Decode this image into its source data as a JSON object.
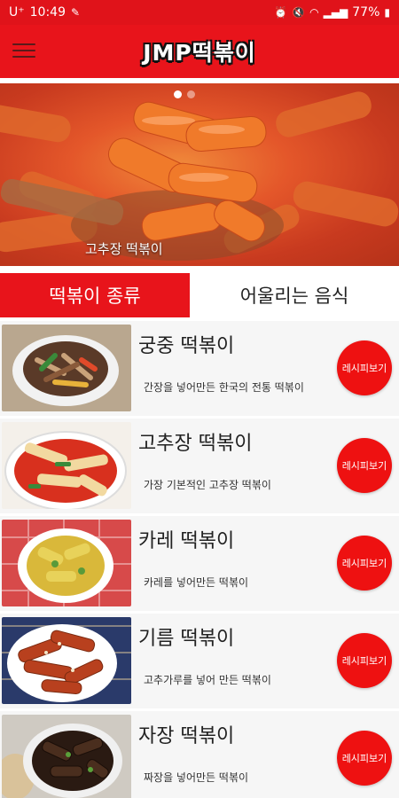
{
  "status_bar": {
    "carrier": "U⁺",
    "time": "10:49",
    "battery": "77%"
  },
  "app_bar": {
    "title": "JMP떡볶이",
    "menu_icon": "hamburger-menu-icon"
  },
  "hero": {
    "caption": "고추장 떡볶이",
    "dots": 2,
    "active_dot": 0
  },
  "tabs": [
    {
      "label": "떡볶이 종류",
      "active": true
    },
    {
      "label": "어울리는 음식",
      "active": false
    }
  ],
  "items": [
    {
      "title": "궁중 떡볶이",
      "desc": "간장을 넣어만든 한국의 전통 떡볶이",
      "button": "레시피보기"
    },
    {
      "title": "고추장 떡볶이",
      "desc": "가장 기본적인 고추장 떡볶이",
      "button": "레시피보기"
    },
    {
      "title": "카레 떡볶이",
      "desc": "카레를 넣어만든 떡볶이",
      "button": "레시피보기"
    },
    {
      "title": "기름 떡볶이",
      "desc": "고추가루를 넣어 만든 떡볶이",
      "button": "레시피보기"
    },
    {
      "title": "자장 떡볶이",
      "desc": "짜장을 넣어만든 떡볶이",
      "button": "레시피보기"
    }
  ],
  "colors": {
    "primary": "#e8141b",
    "recipe_button": "#ee1111"
  }
}
